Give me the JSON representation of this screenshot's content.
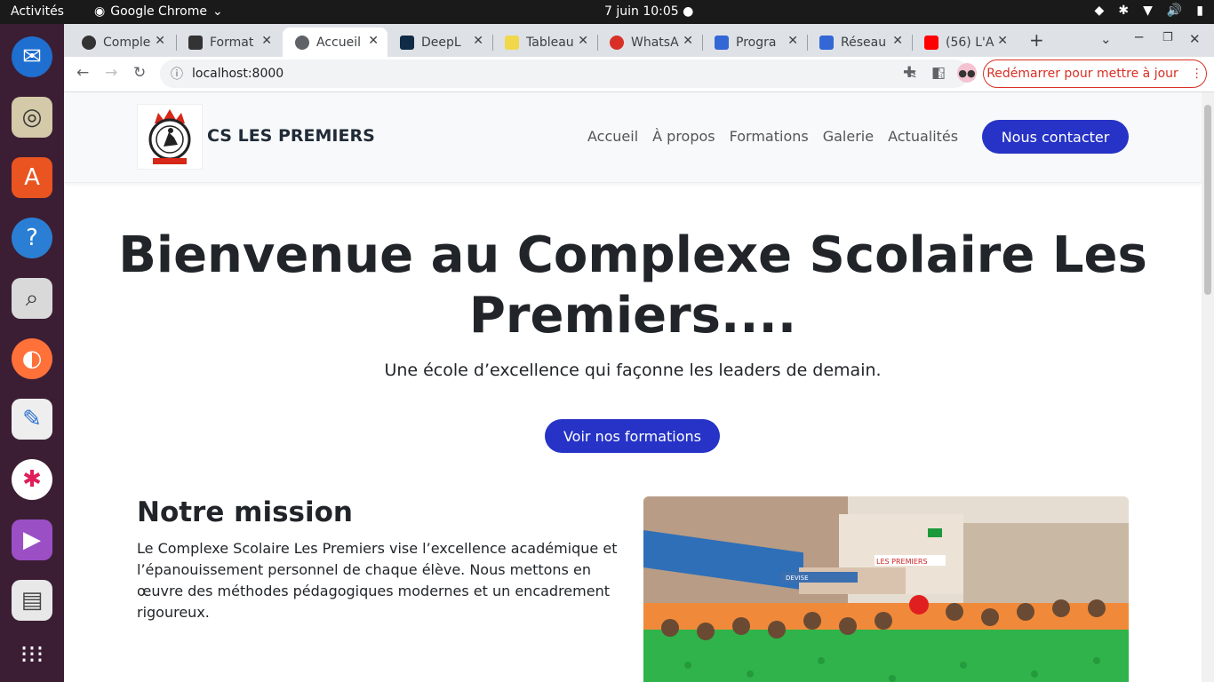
{
  "system": {
    "activities": "Activités",
    "app_name": "Google Chrome",
    "clock": "7 juin  10:05"
  },
  "tabs": [
    {
      "title": "Comple",
      "color": "#333333"
    },
    {
      "title": "Format",
      "color": "#333333"
    },
    {
      "title": "Accueil",
      "color": "#5f6368"
    },
    {
      "title": "DeepL",
      "color": "#0f2b46"
    },
    {
      "title": "Tableau",
      "color": "#f1d84b"
    },
    {
      "title": "WhatsA",
      "color": "#d93025"
    },
    {
      "title": "Progra",
      "color": "#3367d6"
    },
    {
      "title": "Réseau",
      "color": "#3367d6"
    },
    {
      "title": "(56) L'A",
      "color": "#ff0000"
    }
  ],
  "toolbar": {
    "url": "localhost:8000",
    "update_label": "Redémarrer pour mettre à jour"
  },
  "site": {
    "brand": "CS LES PREMIERS",
    "nav": [
      "Accueil",
      "À propos",
      "Formations",
      "Galerie",
      "Actualités"
    ],
    "cta": "Nous contacter",
    "hero_title_line1": "Bienvenue au Complexe Scolaire Les",
    "hero_title_line2": "Premiers....",
    "hero_subtitle": "Une école d’excellence qui façonne les leaders de demain.",
    "hero_button": "Voir nos formations",
    "mission_title": "Notre mission",
    "mission_text": "Le Complexe Scolaire Les Premiers vise l’excellence académique et l’épanouissement personnel de chaque élève. Nous mettons en œuvre des méthodes pédagogiques modernes et un encadrement rigoureux.",
    "photo_sign": "LES PREMIERS",
    "photo_banner": "DEVISE"
  },
  "colors": {
    "accent": "#2633c6",
    "dock": "#3b1e34"
  }
}
